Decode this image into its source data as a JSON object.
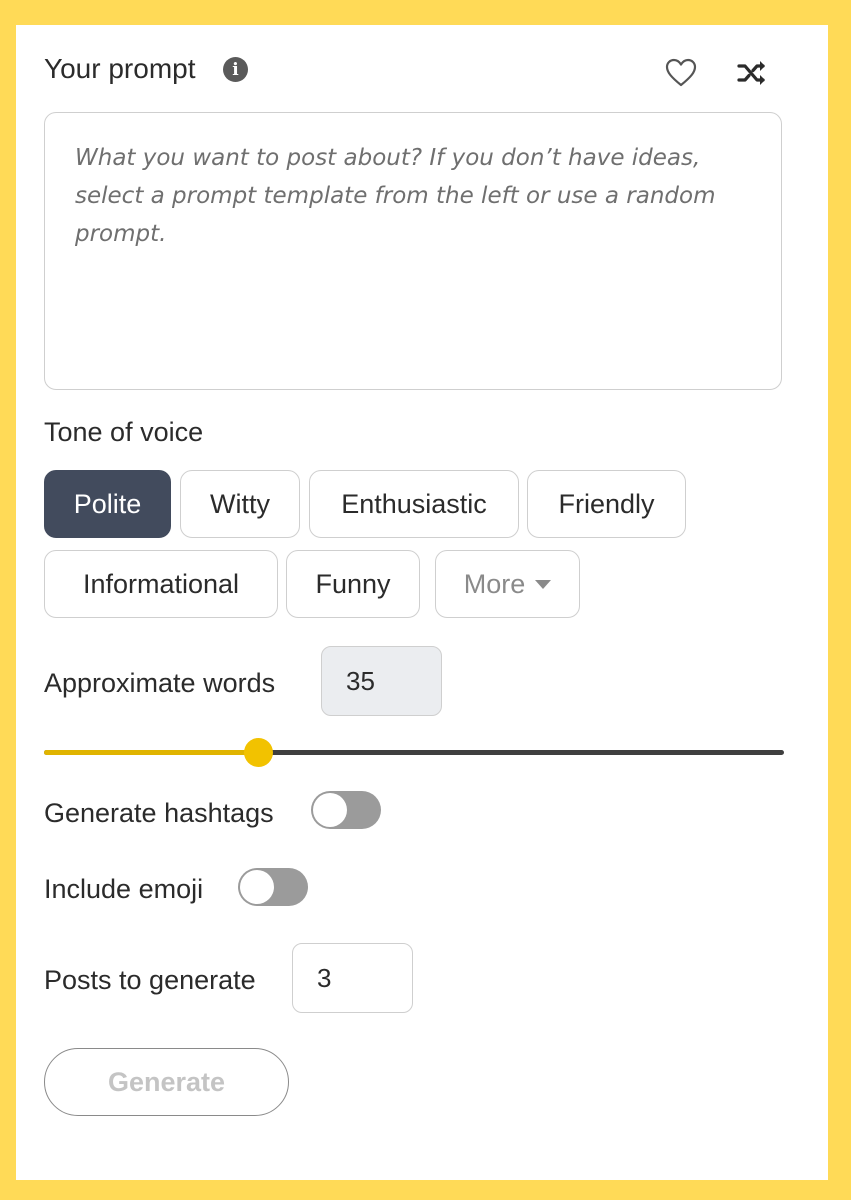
{
  "prompt": {
    "title": "Your prompt",
    "info_icon": "info-icon",
    "placeholder": "What you want to post about? If you don’t have ideas, select a prompt template from the left or use a random prompt.",
    "value": ""
  },
  "tone": {
    "label": "Tone of voice",
    "options": [
      "Polite",
      "Witty",
      "Enthusiastic",
      "Friendly",
      "Informational",
      "Funny"
    ],
    "selected": "Polite",
    "more_label": "More"
  },
  "words": {
    "label": "Approximate words",
    "value": "35",
    "slider_fraction": 0.29
  },
  "hashtags": {
    "label": "Generate hashtags",
    "enabled": false
  },
  "emoji": {
    "label": "Include emoji",
    "enabled": false
  },
  "posts": {
    "label": "Posts to generate",
    "value": "3"
  },
  "generate": {
    "label": "Generate"
  },
  "colors": {
    "background": "#FFDA57",
    "selected_chip": "#424b5d",
    "slider_accent": "#f2c200",
    "toggle_off": "#9b9b9b"
  }
}
